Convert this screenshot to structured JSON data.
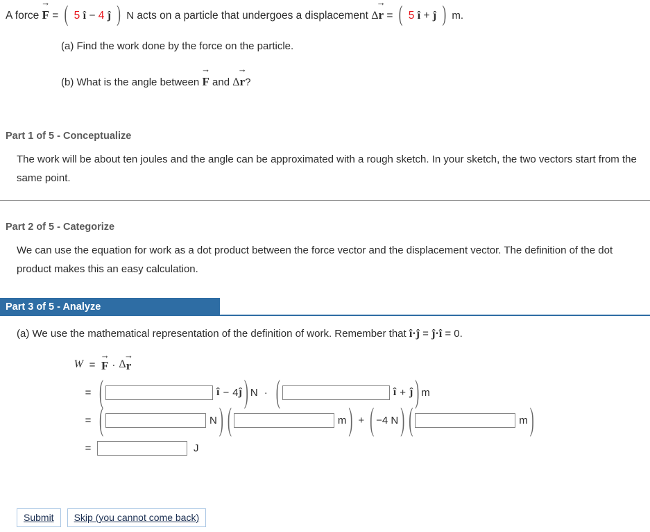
{
  "problem": {
    "lead": "A force",
    "force_symbol": "F",
    "eq": "=",
    "force_i_coef": "5",
    "force_i_hat": "î",
    "force_minus": "−",
    "force_j_coef": "4",
    "force_j_hat": "ĵ",
    "force_unit": "N",
    "middle_text": "acts on a particle that undergoes a displacement",
    "disp_delta": "Δ",
    "disp_symbol": "r",
    "disp_eq": "=",
    "disp_i_coef": "5",
    "disp_i_hat": "î",
    "disp_plus": "+",
    "disp_j_hat": "ĵ",
    "disp_unit": "m.",
    "question_a": "(a) Find the work done by the force on the particle.",
    "question_b_pre": "(b) What is the angle between",
    "question_b_force": "F",
    "question_b_and": "and",
    "question_b_delta": "Δ",
    "question_b_disp": "r",
    "question_b_post": "?"
  },
  "parts": [
    {
      "heading": "Part 1 of 5 - Conceptualize",
      "body": "The work will be about ten joules and the angle can be approximated with a rough sketch. In your sketch, the two vectors start from the same point."
    },
    {
      "heading": "Part 2 of 5 - Categorize",
      "body": "We can use the equation for work as a dot product between the force vector and the displacement vector. The definition of the dot product makes this an easy calculation."
    }
  ],
  "active_part": {
    "heading": "Part 3 of 5 - Analyze",
    "banner_color": "#2e6da4",
    "intro_pre": "(a) We use the mathematical representation of the definition of work. Remember that",
    "intro_ihat": "î",
    "intro_dot1": "·",
    "intro_jhat": "ĵ",
    "intro_eq1": "=",
    "intro_jhat2": "ĵ",
    "intro_dot2": "·",
    "intro_ihat2": "î",
    "intro_eq2": "= 0.",
    "equation": {
      "W": "W",
      "equals": "=",
      "force_symbol": "F",
      "dot": "·",
      "delta": "Δ",
      "disp_symbol": "r"
    },
    "row1": {
      "equals": "=",
      "input1_value": "",
      "input1_placeholder": "",
      "i_hat": "î",
      "minus": "−",
      "coef4": "4",
      "j_hat": "ĵ",
      "unit_N": "N",
      "dot": "·",
      "input2_value": "",
      "input2_placeholder": "",
      "i_hat2": "î",
      "plus": "+",
      "j_hat2": "ĵ",
      "unit_m": "m"
    },
    "row2": {
      "equals": "=",
      "input1_value": "",
      "unit_N": "N",
      "input2_value": "",
      "unit_m": "m",
      "plus": "+",
      "neg4N": "−4 N",
      "input3_value": "",
      "unit_m2": "m"
    },
    "row3": {
      "equals": "=",
      "input1_value": "",
      "unit_J": "J"
    }
  },
  "footer": {
    "submit_label": "Submit",
    "skip_label": "Skip (you cannot come back)"
  }
}
